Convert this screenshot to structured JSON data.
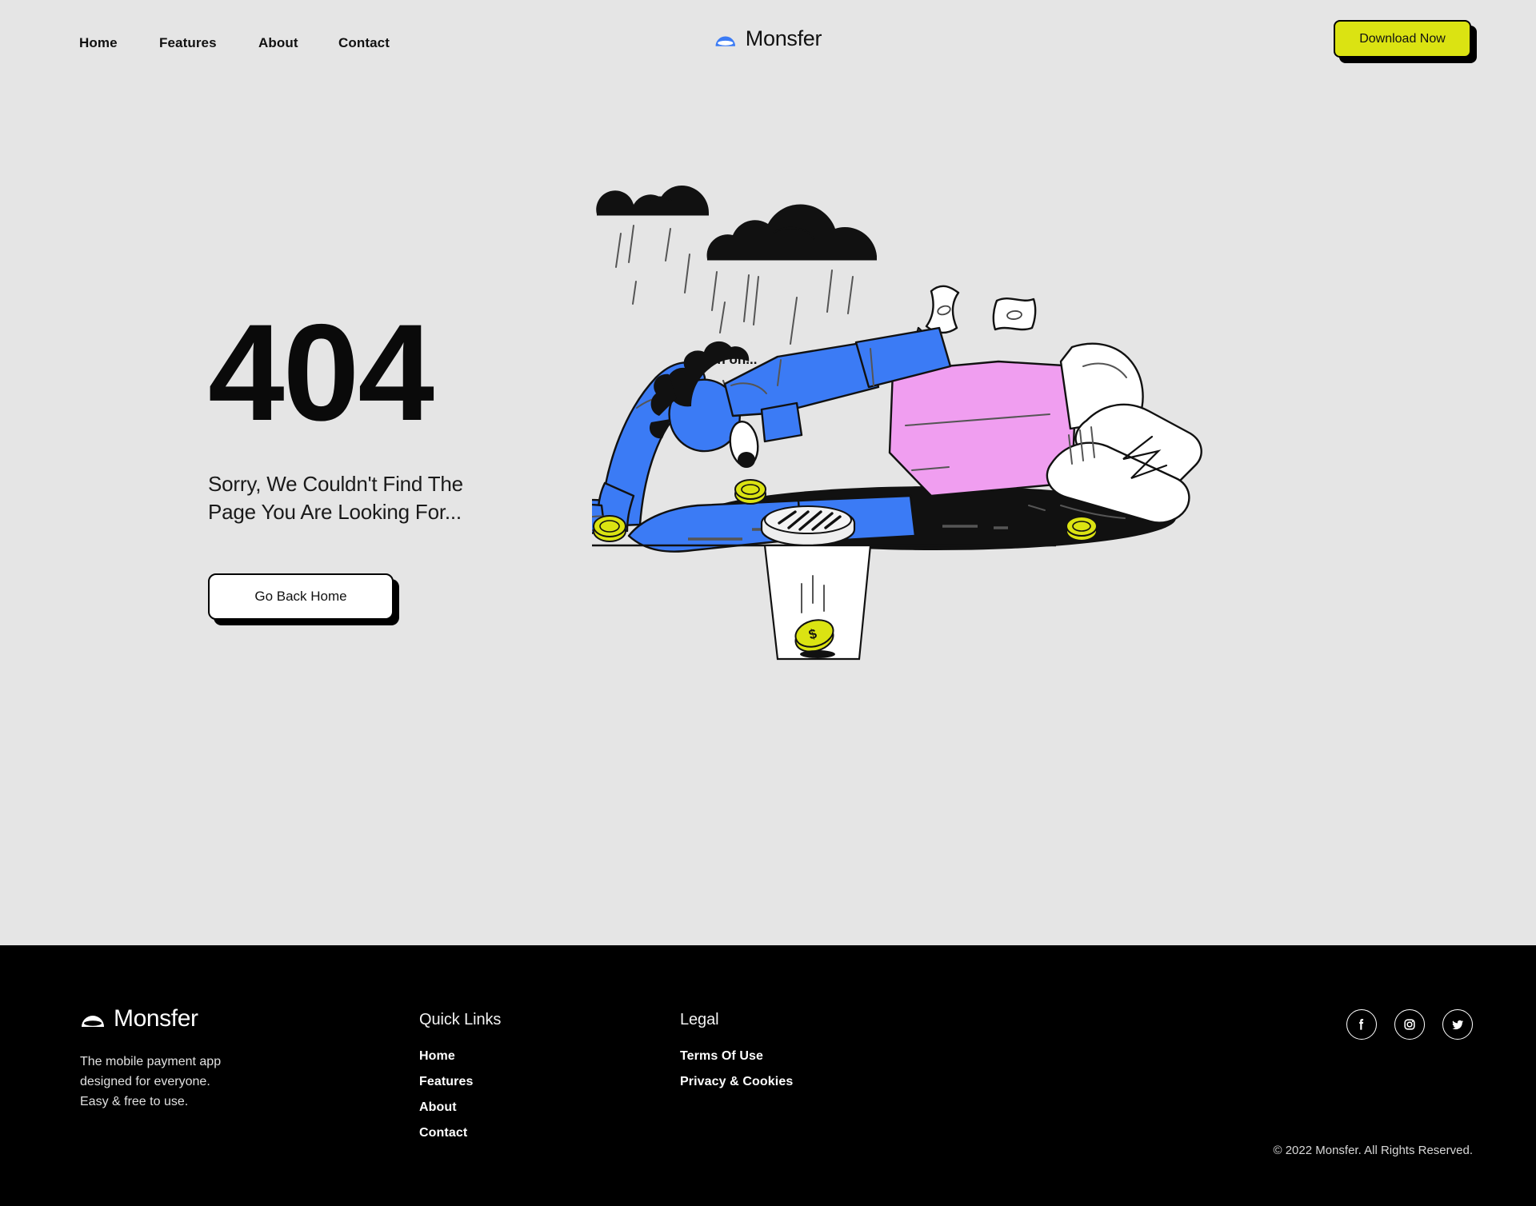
{
  "brand": {
    "name": "Monsfer",
    "logo_icon": "monsfer-dome-icon",
    "blue": "#3b7bf5"
  },
  "header": {
    "nav": [
      {
        "label": "Home"
      },
      {
        "label": "Features"
      },
      {
        "label": "About"
      },
      {
        "label": "Contact"
      }
    ],
    "cta": {
      "label": "Download Now",
      "bg": "#dbe312"
    }
  },
  "hero": {
    "code": "404",
    "subtitle": "Sorry, We Couldn't Find The Page You Are Looking For...",
    "button": {
      "label": "Go Back Home"
    },
    "illustration": {
      "speech": "uh oh...",
      "alt": "person lying on street reaching toward a storm drain while coins and banknotes fall, rain clouds above",
      "colors": {
        "blue": "#3b7bf5",
        "pink": "#f09ef0",
        "coin": "#dbe312",
        "ink": "#111111"
      }
    }
  },
  "footer": {
    "brand_name": "Monsfer",
    "tagline": "The mobile payment app\ndesigned for everyone.\nEasy & free to use.",
    "tagline_lines": [
      "The mobile payment app",
      "designed for everyone.",
      "Easy & free to use."
    ],
    "quick_links": {
      "heading": "Quick Links",
      "items": [
        {
          "label": "Home"
        },
        {
          "label": "Features"
        },
        {
          "label": "About"
        },
        {
          "label": "Contact"
        }
      ]
    },
    "legal": {
      "heading": "Legal",
      "items": [
        {
          "label": "Terms Of Use"
        },
        {
          "label": "Privacy & Cookies"
        }
      ]
    },
    "socials": [
      {
        "name": "facebook-icon"
      },
      {
        "name": "instagram-icon"
      },
      {
        "name": "twitter-icon"
      }
    ],
    "copyright": "© 2022 Monsfer. All Rights Reserved."
  }
}
